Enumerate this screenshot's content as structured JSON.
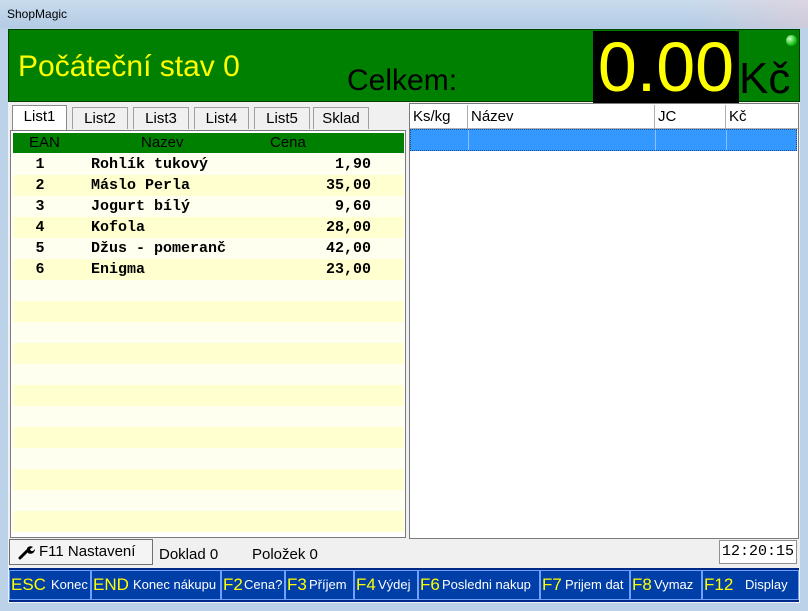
{
  "window": {
    "title": "ShopMagic"
  },
  "header": {
    "status_title": "Počáteční stav 0",
    "total_label": "Celkem:",
    "total_amount": "0.00",
    "currency": "Kč",
    "indicator_color": "#22cc22"
  },
  "tabs": [
    "List1",
    "List2",
    "List3",
    "List4",
    "List5",
    "Sklad"
  ],
  "active_tab": "List1",
  "product_list": {
    "columns": {
      "ean": "EAN",
      "name": "Nazev",
      "price": "Cena"
    },
    "rows": [
      {
        "ean": "1",
        "name": "Rohlík tukový",
        "price": "1,90"
      },
      {
        "ean": "2",
        "name": "Máslo Perla",
        "price": "35,00"
      },
      {
        "ean": "3",
        "name": "Jogurt bílý",
        "price": "9,60"
      },
      {
        "ean": "4",
        "name": "Kofola",
        "price": "28,00"
      },
      {
        "ean": "5",
        "name": "Džus - pomeranč",
        "price": "42,00"
      },
      {
        "ean": "6",
        "name": "Enigma",
        "price": "23,00"
      }
    ]
  },
  "receipt": {
    "columns": [
      "Ks/kg",
      "Název",
      "JC",
      "Kč"
    ]
  },
  "statusbar": {
    "settings": "F11 Nastavení",
    "doc": "Doklad 0",
    "items": "Položek 0",
    "time": "12:20:15"
  },
  "function_keys": [
    {
      "key": "ESC",
      "label": "Konec"
    },
    {
      "key": "END",
      "label": "Konec nákupu"
    },
    {
      "key": "F2",
      "label": "Cena?"
    },
    {
      "key": "F3",
      "label": "Příjem"
    },
    {
      "key": "F4",
      "label": "Výdej"
    },
    {
      "key": "F6",
      "label": "Posledni nakup"
    },
    {
      "key": "F7",
      "label": "Prijem dat"
    },
    {
      "key": "F8",
      "label": "Vymaz"
    },
    {
      "key": "F12",
      "label": "Display"
    }
  ],
  "colors": {
    "header_bg": "#008000",
    "accent_yellow": "#ffff00",
    "fkey_bg": "#003ea8",
    "selection": "#3399ff"
  }
}
